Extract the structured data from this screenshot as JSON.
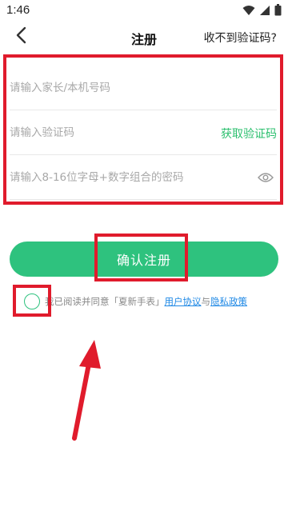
{
  "status_bar": {
    "time": "1:46"
  },
  "nav": {
    "title": "注册",
    "help_link": "收不到验证码?"
  },
  "form": {
    "phone_placeholder": "请输入家长/本机号码",
    "code_placeholder": "请输入验证码",
    "get_code_label": "获取验证码",
    "password_placeholder": "请输入8-16位字母+数字组合的密码"
  },
  "submit": {
    "label": "确认注册"
  },
  "agreement": {
    "text": "我已阅读并同意「夏新手表」",
    "user_agreement": "用户协议",
    "conjunction": "与",
    "privacy_policy": "隐私政策"
  },
  "colors": {
    "accent": "#2ec27e",
    "link": "#1e88e5",
    "annotation": "#e01b2c"
  },
  "icons": [
    "back-icon",
    "eye-icon",
    "wifi-icon",
    "signal-icon",
    "battery-icon"
  ]
}
